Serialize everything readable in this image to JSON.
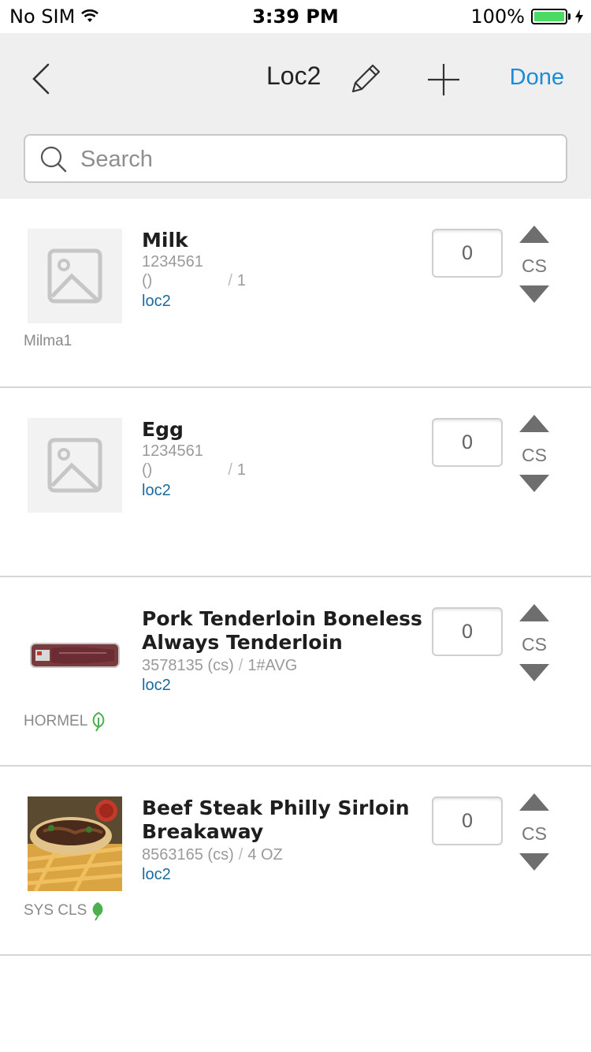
{
  "status_bar": {
    "carrier": "No SIM",
    "time": "3:39 PM",
    "battery": "100%"
  },
  "header": {
    "title": "Loc2",
    "done_label": "Done"
  },
  "search": {
    "placeholder": "Search"
  },
  "colors": {
    "accent": "#1a8cd8",
    "location": "#1a6aa0",
    "sustainable_leaf": "#4caf50"
  },
  "items": [
    {
      "name": "Milk",
      "code": "1234561",
      "pack": "()",
      "size": "1",
      "location": "loc2",
      "brand": "Milma1",
      "quantity": "0",
      "unit": "CS",
      "image": "placeholder-image-icon"
    },
    {
      "name": "Egg",
      "code": "1234561",
      "pack": "()",
      "size": "1",
      "location": "loc2",
      "brand": "",
      "quantity": "0",
      "unit": "CS",
      "image": "placeholder-image-icon"
    },
    {
      "name": "Pork Tenderloin Boneless Always Tenderloin",
      "code": "3578135 (cs)",
      "size": "1#AVG",
      "location": "loc2",
      "brand": "HORMEL",
      "quantity": "0",
      "unit": "CS",
      "image": "pork-tenderloin-photo",
      "leaf": "outline"
    },
    {
      "name": "Beef Steak Philly Sirloin Breakaway",
      "code": "8563165 (cs)",
      "size": "4 OZ",
      "location": "loc2",
      "brand": "SYS CLS",
      "quantity": "0",
      "unit": "CS",
      "image": "philly-steak-photo",
      "leaf": "filled"
    }
  ]
}
